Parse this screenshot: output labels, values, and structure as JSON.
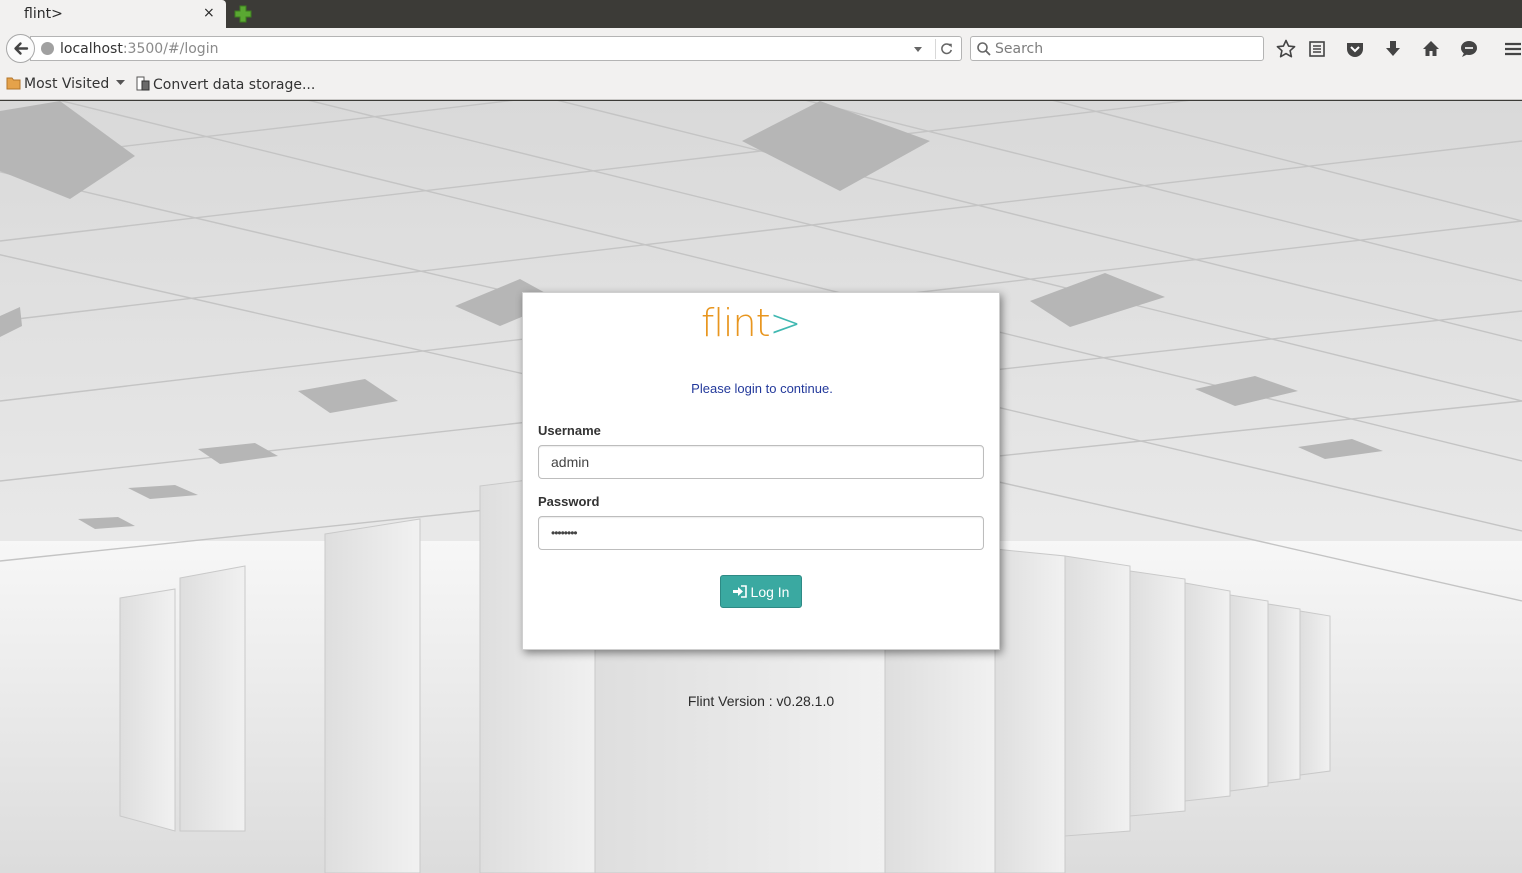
{
  "browser": {
    "tab_title": "flint>",
    "tab_close": "×",
    "url_host": "localhost",
    "url_rest": ":3500/#/login",
    "search_placeholder": "Search",
    "bookmarks": [
      {
        "label": "Most Visited",
        "icon": "folder-icon"
      },
      {
        "label": "Convert data storage...",
        "icon": "page-icon"
      }
    ],
    "toolbar_icons": [
      "bookmark-star-icon",
      "reading-list-icon",
      "pocket-icon",
      "download-icon",
      "home-icon",
      "chat-icon",
      "hamburger-menu-icon"
    ]
  },
  "login": {
    "logo_text": "flint",
    "logo_arrow": ">",
    "message": "Please login to continue.",
    "username_label": "Username",
    "username_value": "admin",
    "password_label": "Password",
    "password_value": "••••••••",
    "button_label": "Log In",
    "button_icon": "sign-in-icon"
  },
  "footer": {
    "version_text": "Flint Version : v0.28.1.0"
  },
  "colors": {
    "logo_orange": "#e8961f",
    "logo_teal": "#3fb8b1",
    "message_blue": "#23399b",
    "button_teal": "#3aa9a1"
  }
}
